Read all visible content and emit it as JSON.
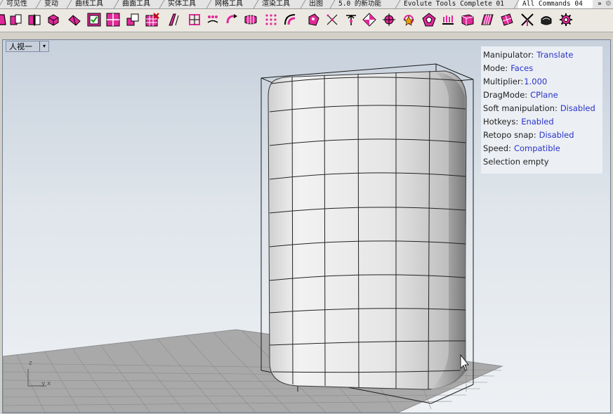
{
  "tabs": [
    {
      "label": "可见性",
      "active": false
    },
    {
      "label": "变动",
      "active": false
    },
    {
      "label": "曲线工具",
      "active": false
    },
    {
      "label": "曲面工具",
      "active": false
    },
    {
      "label": "实体工具",
      "active": false
    },
    {
      "label": "网格工具",
      "active": false
    },
    {
      "label": "渲染工具",
      "active": false
    },
    {
      "label": "出图",
      "active": false
    },
    {
      "label": "5.0 的新功能",
      "active": false
    },
    {
      "label": "Evolute Tools Complete 01",
      "active": false
    },
    {
      "label": "All Commands 04",
      "active": true
    }
  ],
  "tab_overflow": "»",
  "toolbar_icons": [
    "extrude-icon",
    "box-wireframe-icon",
    "split-icon",
    "solid-icon",
    "twist-icon",
    "checkbox-icon",
    "grid-icon",
    "align-icon",
    "delete-grid-icon",
    "brush-icon",
    "network-icon",
    "dots-icon",
    "curve-arrow-icon",
    "mesh-strip-icon",
    "dots-grid-icon",
    "arc-icon",
    "palette-icon",
    "scatter-icon",
    "split-arrows-icon",
    "diamond-icon",
    "target-icon",
    "refresh-star-icon",
    "pentagon-icon",
    "wave-text-icon",
    "panel-icon",
    "shear-icon",
    "patch-icon",
    "cross-icon",
    "cube-icon",
    "gear-icon"
  ],
  "viewport": {
    "label": "人视一",
    "arrow": "▾"
  },
  "info_panel": [
    {
      "key": "Manipulator:",
      "value": "Translate"
    },
    {
      "key": "Mode:",
      "value": "Faces"
    },
    {
      "key": "Multiplier:",
      "value": "1.000"
    },
    {
      "key": "DragMode:",
      "value": "CPlane"
    },
    {
      "key": "Soft manipulation:",
      "value": "Disabled"
    },
    {
      "key": "Hotkeys:",
      "value": "Enabled"
    },
    {
      "key": "Retopo snap:",
      "value": "Disabled"
    },
    {
      "key": "Speed:",
      "value": "Compatible"
    },
    {
      "key": "Selection empty",
      "value": ""
    }
  ],
  "axes": {
    "z": "z",
    "y": "y",
    "x": "x"
  },
  "colors": {
    "accent": "#2a33c8",
    "icon_magenta": "#d11b8f",
    "grid": "#7a7a7a",
    "floor": "#a9a9a9"
  }
}
